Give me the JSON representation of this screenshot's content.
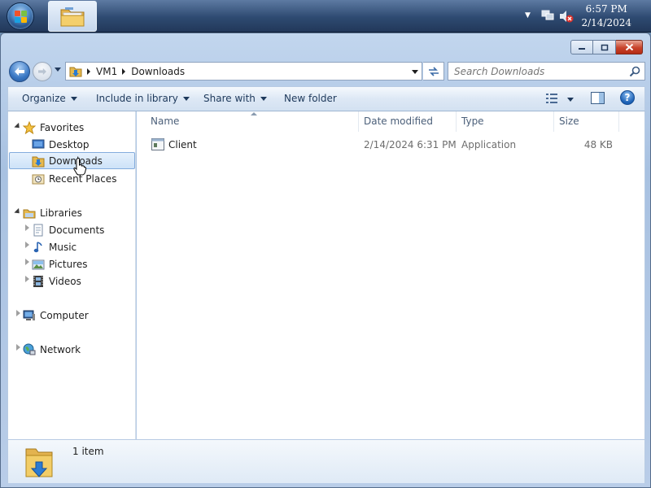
{
  "taskbar": {
    "start_icon": "windows-orb-icon",
    "pinned_app_icon": "folder-explorer-icon",
    "tray": {
      "icons": [
        "show-hidden-icons-chevron",
        "network-icon",
        "volume-muted-icon"
      ],
      "time": "6:57 PM",
      "date": "2/14/2024"
    }
  },
  "window": {
    "address": {
      "crumbs": [
        "VM1",
        "Downloads"
      ]
    },
    "search": {
      "placeholder": "Search Downloads"
    },
    "toolbar": {
      "organize": "Organize",
      "include_in_library": "Include in library",
      "share_with": "Share with",
      "new_folder": "New folder"
    },
    "nav": {
      "favorites": {
        "label": "Favorites",
        "items": [
          "Desktop",
          "Downloads",
          "Recent Places"
        ]
      },
      "libraries": {
        "label": "Libraries",
        "items": [
          "Documents",
          "Music",
          "Pictures",
          "Videos"
        ]
      },
      "computer": "Computer",
      "network": "Network"
    },
    "columns": {
      "name": "Name",
      "date_modified": "Date modified",
      "type": "Type",
      "size": "Size"
    },
    "files": [
      {
        "name": "Client",
        "date_modified": "2/14/2024 6:31 PM",
        "type": "Application",
        "size": "48 KB"
      }
    ],
    "status": {
      "item_count": "1 item"
    }
  },
  "colors": {
    "accent": "#1a5fb4",
    "selection": "#cde2f8",
    "close_button": "#c8432b"
  }
}
